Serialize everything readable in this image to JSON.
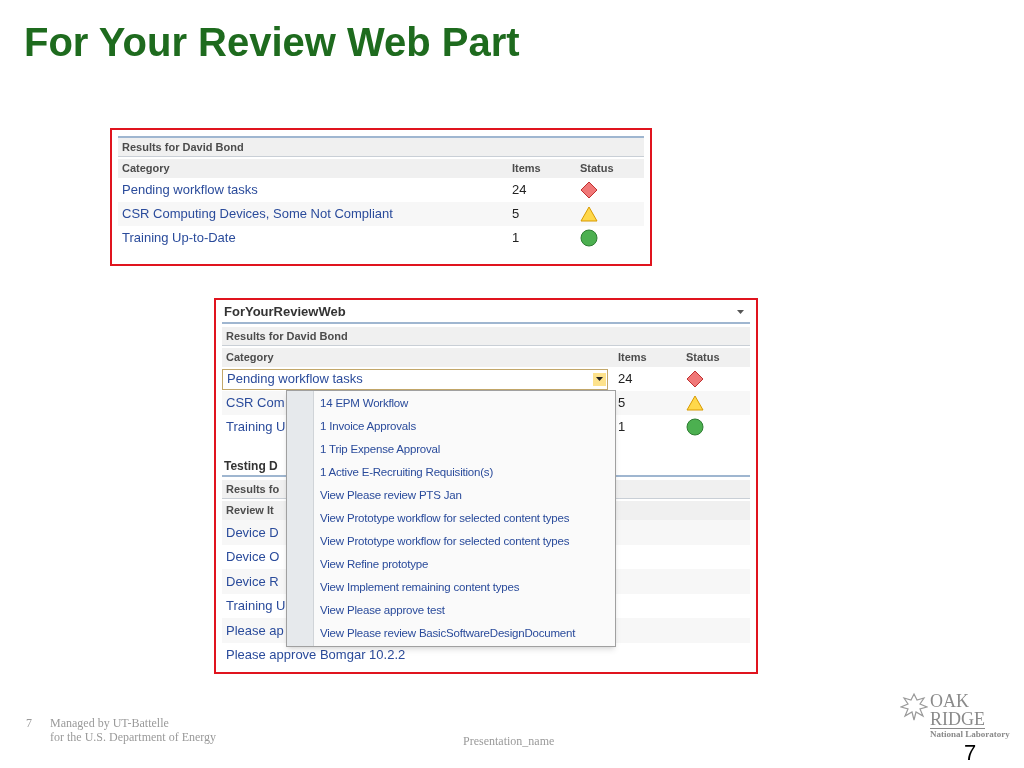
{
  "slide_title": "For Your Review Web Part",
  "panel_1": {
    "header": "Results for David Bond",
    "columns": [
      "Category",
      "Items",
      "Status"
    ],
    "rows": [
      {
        "category": "Pending workflow tasks",
        "items": "24",
        "kind": "alert"
      },
      {
        "category": "CSR Computing Devices, Some Not Compliant",
        "items": "5",
        "kind": "warning"
      },
      {
        "category": "Training Up-to-Date",
        "items": "1",
        "kind": "ok"
      }
    ]
  },
  "panel_2": {
    "title": "ForYourReviewWeb",
    "header": "Results for David Bond",
    "columns": [
      "Category",
      "Items",
      "Status"
    ],
    "rows": [
      {
        "category": "Pending workflow tasks",
        "items": "24",
        "kind": "alert",
        "expanded": true
      },
      {
        "category": "CSR Com",
        "items": "5",
        "kind": "warning",
        "expanded": false
      },
      {
        "category": "Training U",
        "items": "1",
        "kind": "ok",
        "expanded": false
      }
    ],
    "section_2": {
      "title": "Testing D",
      "header": "Results fo",
      "column": "Review It",
      "rows": [
        "Device D",
        "Device O",
        "Device R",
        "Training U",
        "Please ap",
        "Please approve Bomgar 10.2.2"
      ]
    },
    "dropdown_menu": [
      "14 EPM Workflow",
      "1 Invoice Approvals",
      "1 Trip Expense Approval",
      "1 Active E-Recruiting Requisition(s)",
      "View Please review PTS Jan",
      "View Prototype workflow for selected content types",
      "View Prototype workflow for selected content types",
      "View Refine prototype",
      "View Implement remaining content types",
      "View Please approve test",
      "View Please review BasicSoftwareDesignDocument"
    ]
  },
  "footer": {
    "slide_number": "7",
    "managed_by": "Managed by UT-Battelle",
    "department": "for the U.S. Department of Energy",
    "presentation_name": "Presentation_name",
    "logo_line_1": "OAK",
    "logo_line_2": "RIDGE",
    "logo_line_3": "National Laboratory",
    "page_number": "7"
  }
}
